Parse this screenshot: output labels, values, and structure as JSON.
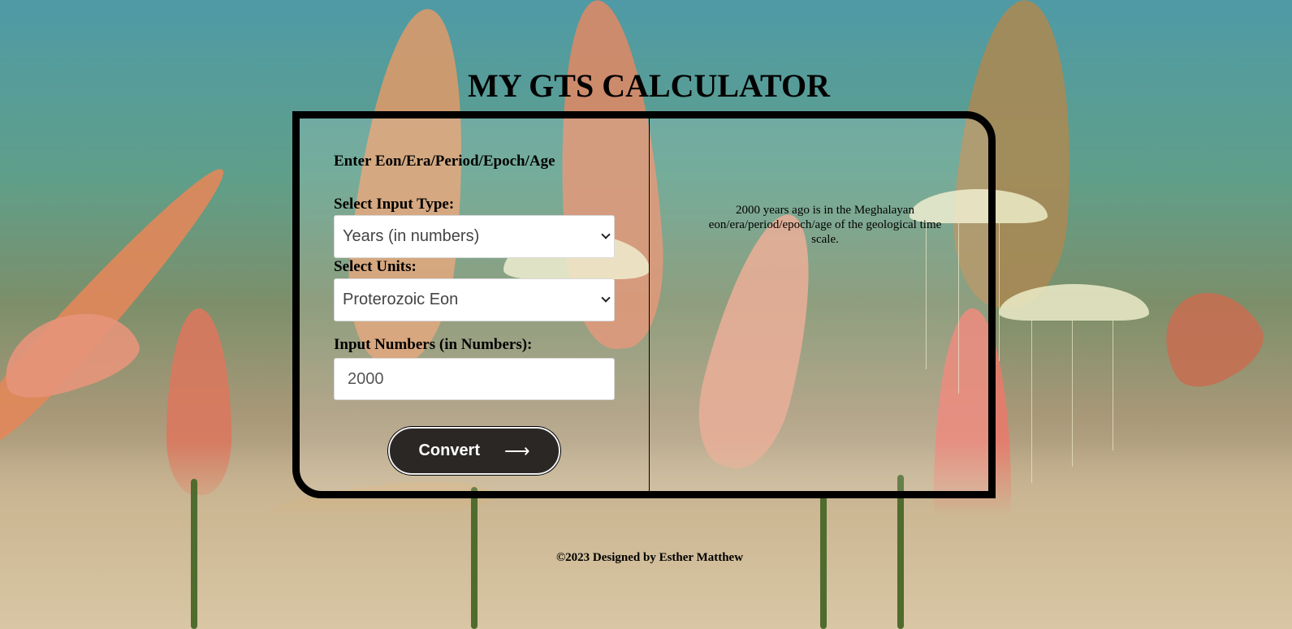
{
  "page": {
    "title": "MY GTS CALCULATOR",
    "footer": "©2023 Designed by Esther Matthew"
  },
  "form": {
    "heading": "Enter Eon/Era/Period/Epoch/Age",
    "input_type_label": "Select Input Type:",
    "input_type_value": "Years (in numbers)",
    "units_label": "Select Units:",
    "units_value": "Proterozoic Eon",
    "number_label": "Input Numbers (in Numbers):",
    "number_value": "2000",
    "convert_label": "Convert",
    "convert_icon": "arrow-right-icon"
  },
  "result": {
    "text": "2000 years ago is in the Meghalayan eon/era/period/epoch/age of the geological time scale."
  },
  "colors": {
    "card_border": "#000000",
    "button_bg": "#2a2725",
    "button_text": "#ffffff"
  }
}
